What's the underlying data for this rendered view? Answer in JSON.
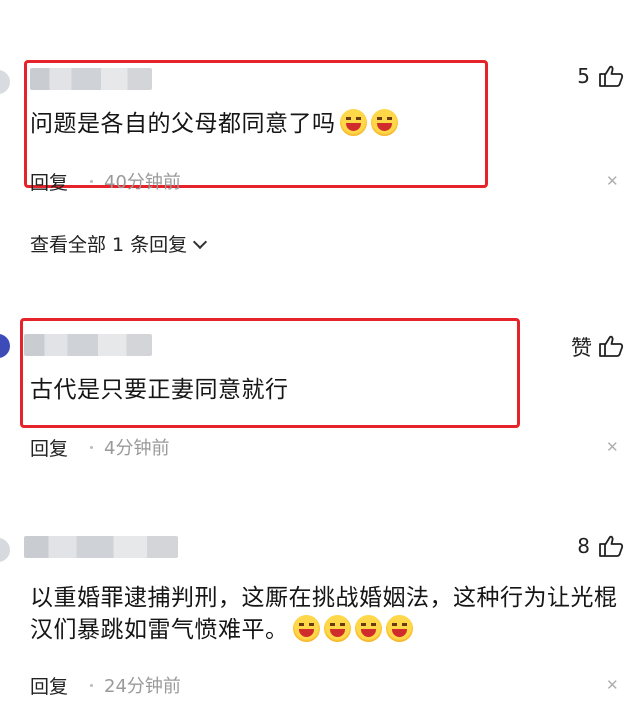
{
  "comments": [
    {
      "text": "问题是各自的父母都同意了吗",
      "emoji_count": 2,
      "reply_label": "回复",
      "time": "40分钟前",
      "likes": "5",
      "view_replies": "查看全部 1 条回复"
    },
    {
      "text": "古代是只要正妻同意就行",
      "reply_label": "回复",
      "time": "4分钟前",
      "likes": "赞"
    },
    {
      "text_line1": "以重婚罪逮捕判刑，这厮在挑战婚姻法，这种行为让光棍",
      "text_line2": "汉们暴跳如雷气愤难平。",
      "emoji_count": 4,
      "reply_label": "回复",
      "time": "24分钟前",
      "likes": "8"
    }
  ],
  "colors": {
    "highlight": "#e5232a",
    "muted": "#9a9a9a"
  },
  "icons": {
    "like": "thumbs-up-icon",
    "close": "close-icon",
    "emoji": "grin-emoji-icon"
  }
}
